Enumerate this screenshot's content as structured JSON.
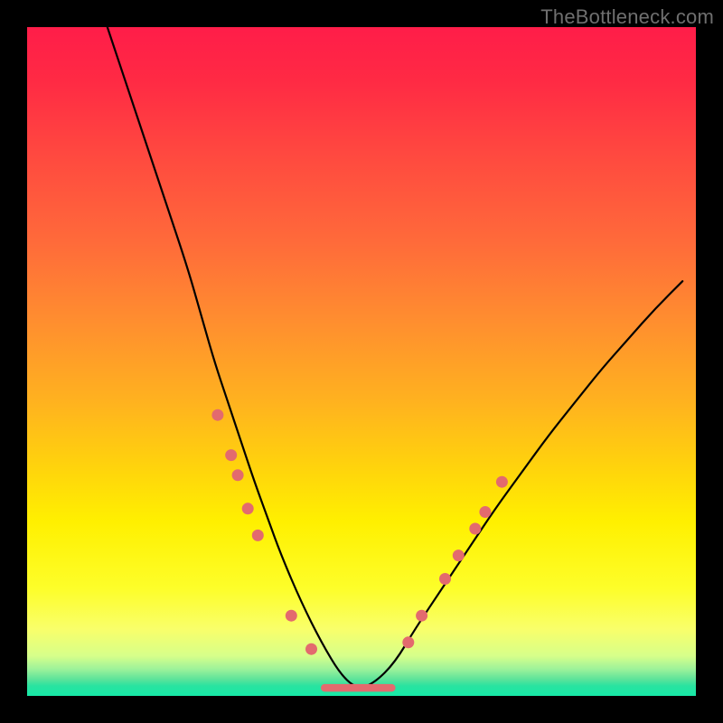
{
  "watermark": "TheBottleneck.com",
  "chart_data": {
    "type": "line",
    "title": "",
    "xlabel": "",
    "ylabel": "",
    "xlim": [
      0,
      100
    ],
    "ylim": [
      0,
      100
    ],
    "grid": false,
    "series": [
      {
        "name": "curve",
        "x": [
          12,
          15,
          18,
          21,
          24,
          26,
          28,
          30,
          32,
          34,
          36,
          38,
          41,
          44,
          47,
          49.5,
          52,
          55,
          58,
          62,
          66,
          70,
          74,
          78,
          82,
          86,
          90,
          94,
          98
        ],
        "y": [
          100,
          91,
          82,
          73,
          64,
          57,
          50,
          44,
          38,
          32,
          26.5,
          21,
          14,
          8,
          3,
          1,
          2,
          5,
          10,
          16,
          22,
          28,
          33.5,
          39,
          44,
          49,
          53.5,
          58,
          62
        ]
      }
    ],
    "markers_left": [
      {
        "x": 28.5,
        "y": 42
      },
      {
        "x": 30.5,
        "y": 36
      },
      {
        "x": 31.5,
        "y": 33
      },
      {
        "x": 33.0,
        "y": 28
      },
      {
        "x": 34.5,
        "y": 24
      },
      {
        "x": 39.5,
        "y": 12
      },
      {
        "x": 42.5,
        "y": 7
      }
    ],
    "markers_right": [
      {
        "x": 57.0,
        "y": 8
      },
      {
        "x": 59.0,
        "y": 12
      },
      {
        "x": 62.5,
        "y": 17.5
      },
      {
        "x": 64.5,
        "y": 21
      },
      {
        "x": 67.0,
        "y": 25
      },
      {
        "x": 68.5,
        "y": 27.5
      },
      {
        "x": 71.0,
        "y": 32
      }
    ],
    "valley": {
      "x0": 44.5,
      "x1": 54.5,
      "y": 1.2
    }
  }
}
